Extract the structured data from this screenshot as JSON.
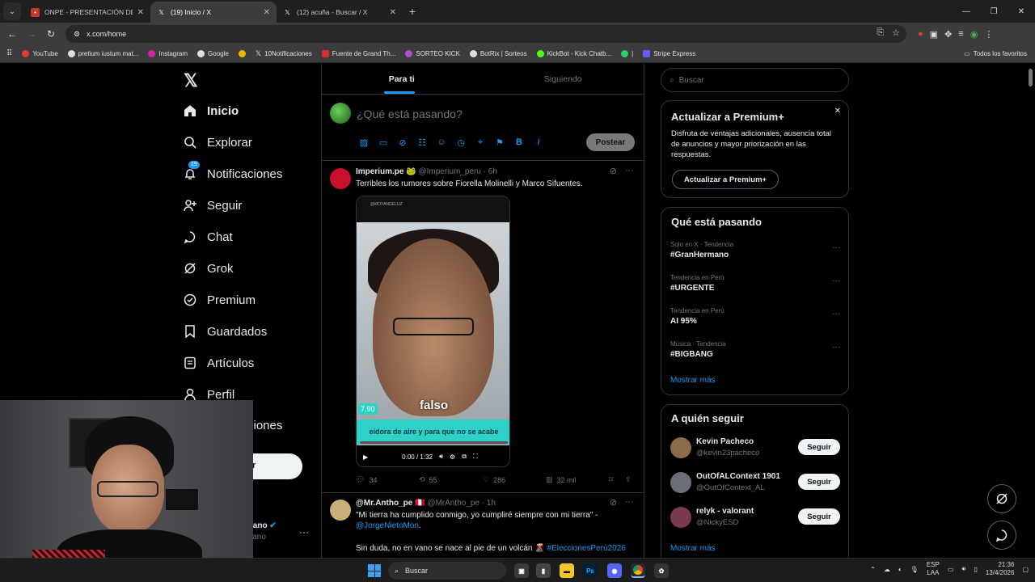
{
  "browser": {
    "tabs": [
      {
        "title": "ONPE - PRESENTACIÓN DE RES",
        "active": false
      },
      {
        "title": "(19) Inicio / X",
        "active": true
      },
      {
        "title": "(12) acuña - Buscar / X",
        "active": false
      }
    ],
    "url": "x.com/home",
    "bookmarks": [
      "YouTube",
      "pretium iustum mat...",
      "Instagram",
      "Google",
      "10Notificaciones",
      "Fuente de Grand Th...",
      "SORTEO KICK",
      "BotRix | Sorteos",
      "KickBot - Kick Chatb...",
      "|",
      "Stripe Express"
    ],
    "all_bookmarks": "Todos los favoritos"
  },
  "nav": {
    "items": [
      {
        "label": "Inicio",
        "icon": "home-icon"
      },
      {
        "label": "Explorar",
        "icon": "search-icon"
      },
      {
        "label": "Notificaciones",
        "icon": "bell-icon",
        "badge": "19"
      },
      {
        "label": "Seguir",
        "icon": "person-add-icon"
      },
      {
        "label": "Chat",
        "icon": "chat-icon"
      },
      {
        "label": "Grok",
        "icon": "grok-icon"
      },
      {
        "label": "Premium",
        "icon": "premium-icon"
      },
      {
        "label": "Guardados",
        "icon": "bookmark-icon"
      },
      {
        "label": "Artículos",
        "icon": "articles-icon"
      },
      {
        "label": "Perfil",
        "icon": "profile-icon"
      },
      {
        "label": "ciones",
        "icon": ""
      }
    ],
    "post_label": "r",
    "account_name": "iano",
    "account_handle": "lano"
  },
  "feed": {
    "tabs": [
      "Para ti",
      "Siguiendo"
    ],
    "composer_placeholder": "¿Qué está pasando?",
    "post_button": "Postear",
    "tweets": [
      {
        "name": "Imperium.pe 🐸",
        "handle": "@Imperium_peru",
        "time": "· 6h",
        "text": "Terribles los rumores sobre Fiorella Molinelli y Marco Sifuentes.",
        "video": {
          "watermark": "@MOYANGELUZ",
          "caption": "falso",
          "subtitle": "eidora de aire y para que no se acabe",
          "number": "7.90",
          "time": "0:00 / 1:32",
          "progress": 0.0
        },
        "replies": "34",
        "reposts": "55",
        "likes": "286",
        "views": "32 mil"
      },
      {
        "name": "@Mr.Antho_pe 🇵🇪",
        "handle": "@MrAntho_pe",
        "time": "· 1h",
        "text1": "\"Mi tierra ha cumplido conmigo, yo cumpliré siempre con mi tierra\" -",
        "mention": "@JorgeNietoMon",
        "text2": "Sin duda, no en vano se nace al pie de un volcán 🌋",
        "hashtag": "#EleccionesPerú2026"
      }
    ]
  },
  "sidebar": {
    "search_placeholder": "Buscar",
    "premium": {
      "title": "Actualizar a Premium+",
      "text": "Disfruta de ventajas adicionales, ausencia total de anuncios y mayor priorización en las respuestas.",
      "button": "Actualizar a Premium+"
    },
    "trends_title": "Qué está pasando",
    "trends": [
      {
        "category": "Solo en X · Tendencia",
        "name": "#GranHermano"
      },
      {
        "category": "Tendencia en Perú",
        "name": "#URGENTE"
      },
      {
        "category": "Tendencia en Perú",
        "name": "AI 95%"
      },
      {
        "category": "Música · Tendencia",
        "name": "#BIGBANG"
      }
    ],
    "show_more": "Mostrar más",
    "who_title": "A quién seguir",
    "who": [
      {
        "name": "Kevin Pacheco",
        "handle": "@kevin23pacheco",
        "button": "Seguir"
      },
      {
        "name": "OutOfALContext 1901",
        "handle": "@OutOfContext_AL",
        "button": "Seguir"
      },
      {
        "name": "relyk - valorant",
        "handle": "@NickyESD",
        "button": "Seguir"
      }
    ],
    "show_more_2": "Mostrar más"
  },
  "taskbar": {
    "search": "Buscar",
    "lang1": "ESP",
    "lang2": "LAA",
    "time": "21:36",
    "date": "13/4/2026"
  },
  "colors": {
    "accent": "#1d9bf0",
    "bg": "#000000",
    "border": "#2f3336"
  }
}
